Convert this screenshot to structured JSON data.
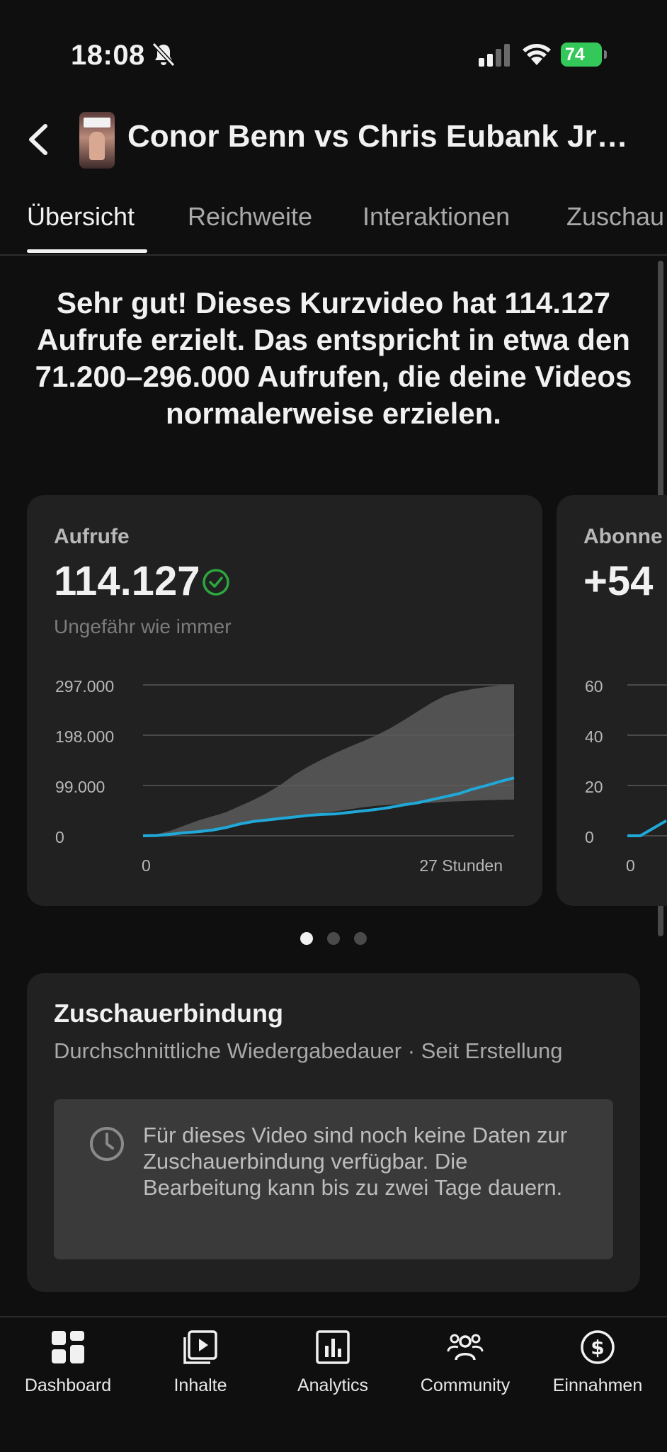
{
  "status_bar": {
    "time": "18:08",
    "battery": "74"
  },
  "header": {
    "title": "Conor Benn vs Chris Eubank Jr…"
  },
  "tabs": [
    {
      "label": "Übersicht"
    },
    {
      "label": "Reichweite"
    },
    {
      "label": "Interaktionen"
    },
    {
      "label": "Zuschau"
    }
  ],
  "headline": "Sehr gut! Dieses Kurzvideo hat 114.127 Aufrufe erzielt. Das entspricht in etwa den 71.200–296.000 Aufrufen, die deine Videos normalerweise erzielen.",
  "metrics": [
    {
      "label": "Aufrufe",
      "value": "114.127",
      "subtitle": "Ungefähr wie immer"
    },
    {
      "label": "Abonne",
      "value": "+54"
    }
  ],
  "chart_data": [
    {
      "type": "line",
      "title": "Aufrufe",
      "ytick_labels": [
        "297.000",
        "198.000",
        "99.000",
        "0"
      ],
      "yticks": [
        297000,
        198000,
        99000,
        0
      ],
      "xtick_labels": [
        "0",
        "27 Stunden"
      ],
      "ylim": [
        0,
        297000
      ],
      "xlim": [
        0,
        27
      ],
      "grid": true,
      "colors": {
        "line": "#20a8d8",
        "band": "#5a5a5a",
        "grid": "#4a4a4a"
      },
      "series": [
        {
          "x": [
            0,
            1,
            2,
            3,
            4,
            5,
            6,
            7,
            8,
            9,
            10,
            11,
            12,
            13,
            14,
            15,
            16,
            17,
            18,
            19,
            20,
            21,
            22,
            23,
            24,
            25,
            26,
            27
          ],
          "values": [
            0,
            500,
            3000,
            6000,
            8000,
            11000,
            16000,
            23000,
            28000,
            31000,
            34000,
            37000,
            40000,
            42000,
            43000,
            46000,
            49000,
            52000,
            56000,
            61000,
            65000,
            71000,
            77000,
            83000,
            92000,
            99000,
            107000,
            114127
          ]
        }
      ],
      "band": {
        "upper": [
          0,
          3000,
          10000,
          20000,
          30000,
          38000,
          46000,
          58000,
          70000,
          84000,
          100000,
          120000,
          136000,
          150000,
          163000,
          175000,
          186000,
          198000,
          212000,
          228000,
          245000,
          262000,
          276000,
          284000,
          289000,
          293000,
          296000,
          297000
        ],
        "lower": [
          0,
          0,
          2000,
          5000,
          8000,
          11000,
          16000,
          22000,
          28000,
          32000,
          35000,
          38000,
          42000,
          45000,
          48000,
          52000,
          56000,
          59000,
          61000,
          63000,
          64000,
          65000,
          67000,
          68000,
          69000,
          70000,
          71000,
          71200
        ]
      }
    },
    {
      "type": "line",
      "title": "Abonne",
      "ytick_labels": [
        "60",
        "40",
        "20",
        "0"
      ],
      "yticks": [
        60,
        40,
        20,
        0
      ],
      "xtick_labels": [
        "0"
      ],
      "ylim": [
        0,
        60
      ],
      "grid": true,
      "series": [
        {
          "x": [
            0,
            1,
            2,
            3
          ],
          "values": [
            0,
            0,
            3,
            6
          ]
        }
      ]
    }
  ],
  "pagination": {
    "pages": 3,
    "active": 0
  },
  "retention": {
    "title": "Zuschauerbindung",
    "subtitle": "Durchschnittliche Wiedergabedauer · Seit Erstellung",
    "message": "Für dieses Video sind noch keine Daten zur Zuschauerbindung verfügbar. Die Bearbeitung kann bis zu zwei Tage dauern."
  },
  "bottom_nav": [
    {
      "label": "Dashboard",
      "icon": "dashboard-icon"
    },
    {
      "label": "Inhalte",
      "icon": "content-icon"
    },
    {
      "label": "Analytics",
      "icon": "analytics-icon"
    },
    {
      "label": "Community",
      "icon": "community-icon"
    },
    {
      "label": "Einnahmen",
      "icon": "earnings-icon"
    }
  ]
}
